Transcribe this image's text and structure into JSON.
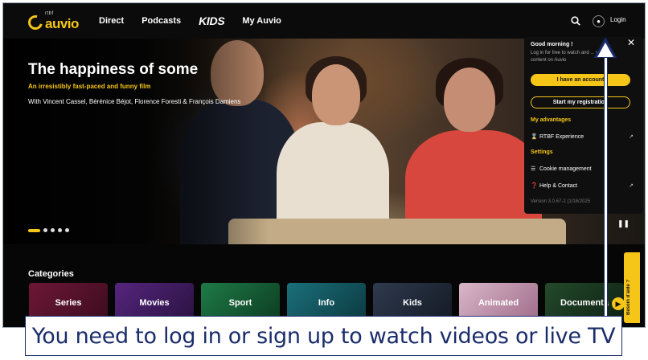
{
  "header": {
    "logo_small": "rtbf",
    "logo_main": "auvio",
    "nav": [
      "Direct",
      "Podcasts",
      "KIDS",
      "My Auvio"
    ],
    "login_label": "Login"
  },
  "hero": {
    "title": "The happiness of some",
    "subtitle": "An irresistibly fast-paced and funny film",
    "cast": "With Vincent Cassel, Bérénice Béjot, Florence Foresti & François Damiens",
    "slides_total": 5,
    "slide_active": 1
  },
  "dropdown": {
    "greeting": "Good morning !",
    "description": "Log in for free to watch and ... your content on Auvio",
    "have_account_label": "I have an account",
    "register_label": "Start my registration",
    "advantages_title": "My advantages",
    "advantage_item": "RTBF Experience",
    "settings_title": "Settings",
    "cookie_label": "Cookie management",
    "help_label": "Help & Contact",
    "version": "Version 3.0.67-2 (1/18/2025"
  },
  "categories": {
    "title": "Categories",
    "items": [
      "Series",
      "Movies",
      "Sport",
      "Info",
      "Kids",
      "Animated",
      "Documenta"
    ]
  },
  "help_tab": "Besoin d'aide ?",
  "banner": "You need to log in or sign up to watch videos or live TV",
  "colors": {
    "accent": "#f5c518",
    "banner_text": "#1a2c6b",
    "background": "#060606"
  }
}
